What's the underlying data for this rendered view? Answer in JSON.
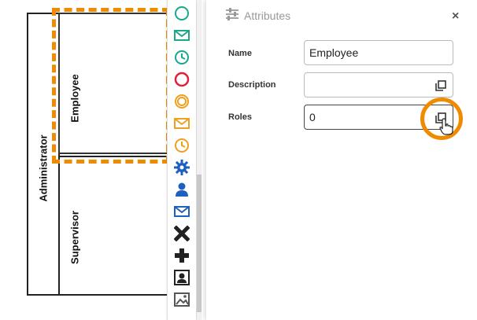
{
  "diagram": {
    "pool_label": "Administrator",
    "lanes": [
      {
        "label": "Employee"
      },
      {
        "label": "Supervisor"
      }
    ],
    "highlight_color": "#f08a00"
  },
  "palette": {
    "items": [
      {
        "icon": "start-event-icon"
      },
      {
        "icon": "message-start-event-icon"
      },
      {
        "icon": "timer-start-event-icon"
      },
      {
        "icon": "end-event-icon"
      },
      {
        "icon": "intermediate-event-icon"
      },
      {
        "icon": "message-intermediate-event-icon"
      },
      {
        "icon": "timer-intermediate-event-icon"
      },
      {
        "icon": "service-task-gear-icon"
      },
      {
        "icon": "user-task-icon"
      },
      {
        "icon": "message-task-icon"
      },
      {
        "icon": "exclusive-gateway-icon"
      },
      {
        "icon": "parallel-gateway-icon"
      },
      {
        "icon": "role-icon"
      },
      {
        "icon": "image-icon"
      }
    ]
  },
  "panel": {
    "title": "Attributes",
    "title_icon": "sliders-icon",
    "close_label": "×",
    "fields": {
      "name": {
        "label": "Name",
        "value": "Employee"
      },
      "description": {
        "label": "Description",
        "value": ""
      },
      "roles": {
        "label": "Roles",
        "value": "0"
      }
    },
    "accent_color": "#f08a00"
  }
}
